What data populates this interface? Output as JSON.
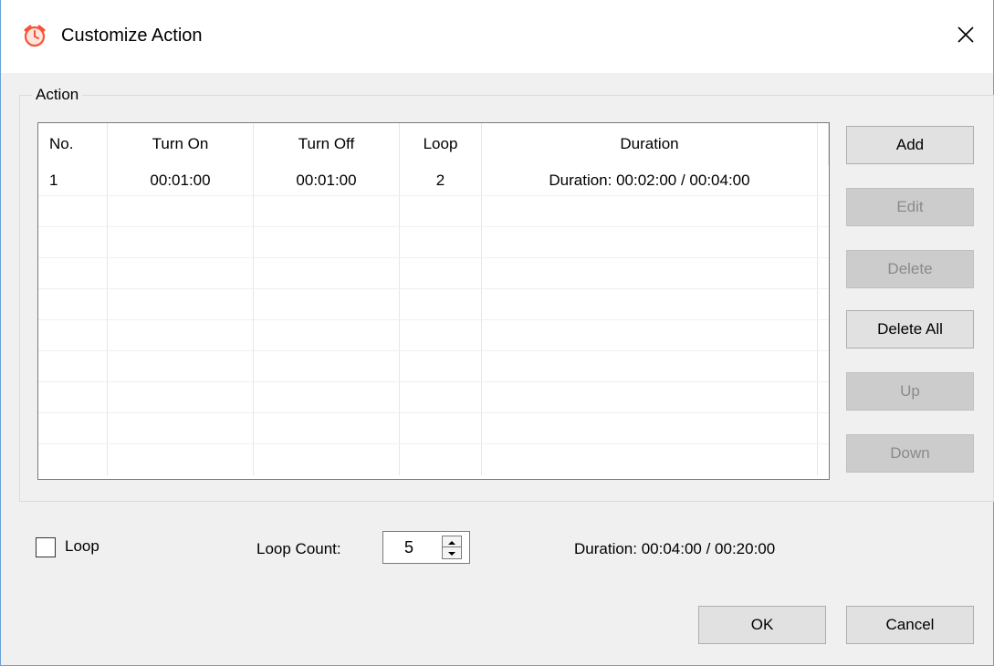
{
  "window": {
    "title": "Customize Action",
    "icon": "alarm-clock-icon",
    "close_icon": "close-icon"
  },
  "action_group": {
    "label": "Action",
    "columns": [
      "No.",
      "Turn On",
      "Turn Off",
      "Loop",
      "Duration"
    ],
    "rows": [
      [
        "1",
        "00:01:00",
        "00:01:00",
        "2",
        "Duration: 00:02:00 / 00:04:00"
      ]
    ]
  },
  "side_buttons": {
    "add": "Add",
    "edit": "Edit",
    "delete": "Delete",
    "delete_all": "Delete All",
    "up": "Up",
    "down": "Down"
  },
  "options": {
    "loop_label": "Loop",
    "loop_checked": false,
    "loop_count_label": "Loop Count:",
    "loop_count_value": "5",
    "total_duration": "Duration: 00:04:00 / 00:20:00"
  },
  "footer": {
    "ok": "OK",
    "cancel": "Cancel"
  },
  "colors": {
    "window_border": "#6aa0d8",
    "icon_orange": "#f2553a",
    "disabled_text": "#8a8a8a"
  }
}
